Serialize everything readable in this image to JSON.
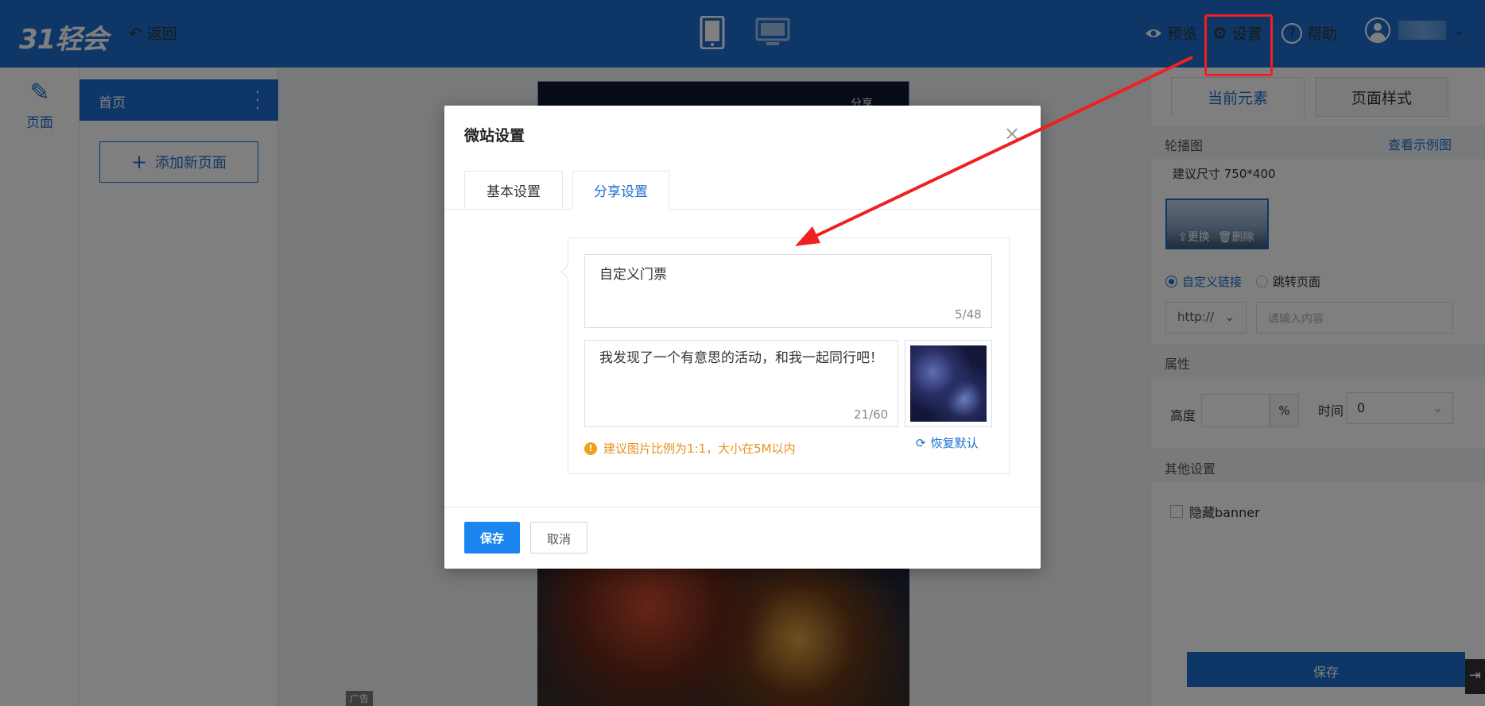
{
  "topbar": {
    "logo": "31轻会",
    "back_label": "返回",
    "preview_label": "预览",
    "settings_label": "设置",
    "help_label": "帮助",
    "accent_color": "#1c6fcf"
  },
  "rail": {
    "page_label": "页面"
  },
  "pages": {
    "items": [
      {
        "label": "首页"
      }
    ],
    "add_page_label": "添加新页面"
  },
  "canvas": {
    "ad_label": "广告",
    "share_hint": "分享"
  },
  "right_panel": {
    "tabs": [
      "当前元素",
      "页面样式"
    ],
    "carousel_label": "轮播图",
    "view_example": "查看示例图",
    "size_hint": "建议尺寸 750*400",
    "replace_label": "更换",
    "delete_label": "删除",
    "link_options": [
      "自定义链接",
      "跳转页面"
    ],
    "selected_link_option": "自定义链接",
    "protocol_value": "http://",
    "url_placeholder": "请输入内容",
    "attributes_label": "属性",
    "height_label": "高度",
    "height_unit": "%",
    "time_label": "时间",
    "time_value": "0",
    "other_settings_label": "其他设置",
    "hide_banner_label": "隐藏banner",
    "save_label": "保存"
  },
  "modal": {
    "title": "微站设置",
    "tabs": [
      "基本设置",
      "分享设置"
    ],
    "active_tab": "分享设置",
    "share_title_value": "自定义门票",
    "share_title_count": "5/48",
    "share_desc_value": "我发现了一个有意思的活动，和我一起同行吧！",
    "share_desc_count": "21/60",
    "image_tip": "建议图片比例为1:1，大小在5M以内",
    "restore_label": "恢复默认",
    "save_label": "保存",
    "cancel_label": "取消"
  },
  "annotation": {
    "color": "#f02020"
  }
}
